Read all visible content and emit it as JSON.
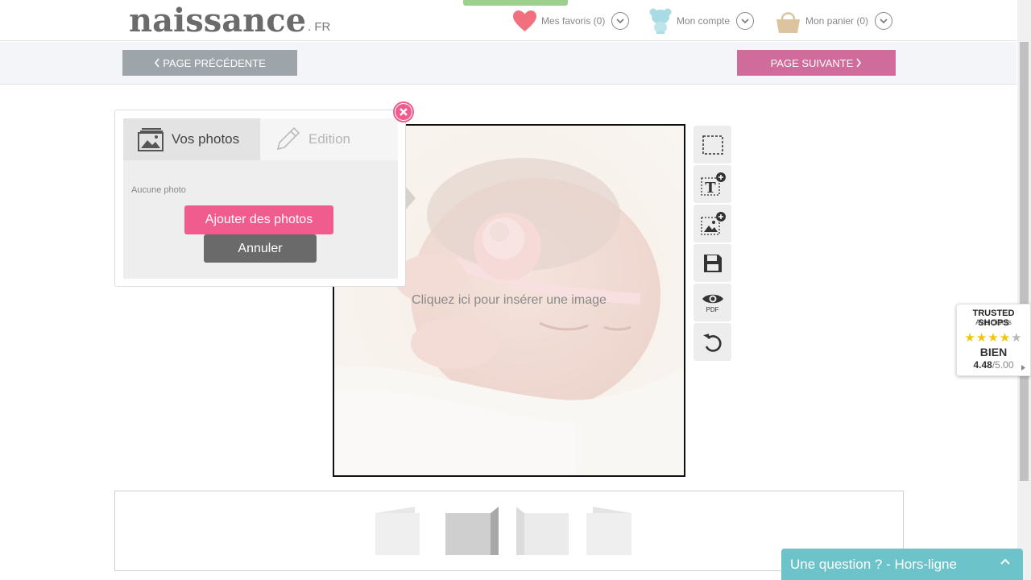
{
  "header": {
    "logo": "naissance",
    "logo_suffix": ". FR",
    "favorites_label": "Mes favoris (0)",
    "account_label": "Mon compte",
    "cart_label": "Mon panier (0)"
  },
  "nav": {
    "prev_label": "PAGE PRÉCÉDENTE",
    "next_label": "PAGE SUIVANTE"
  },
  "panel": {
    "tab_photos": "Vos photos",
    "tab_edition": "Edition",
    "empty_text": "Aucune photo",
    "add_button": "Ajouter des photos",
    "cancel_button": "Annuler"
  },
  "canvas": {
    "hint": "Cliquez ici pour insérer une image"
  },
  "tools": {
    "preview_pdf": "PDF",
    "icons": [
      "select-icon",
      "add-text-icon",
      "add-image-icon",
      "save-icon",
      "preview-pdf-icon",
      "undo-icon"
    ]
  },
  "trusted_shops": {
    "title": "TRUSTED SHOPS",
    "subtitle": "Avis clients",
    "stars": "★★★★★",
    "rating_word": "BIEN",
    "score": "4.48",
    "max": "/5.00",
    "rating_fraction": 0.896
  },
  "chat": {
    "label": "Une question ? - Hors-ligne"
  },
  "colors": {
    "accent_pink": "#f05c8e",
    "next_button": "#cf6c9b",
    "prev_button": "#9ea5aa",
    "chat": "#6cc3c9",
    "star": "#f5c400"
  }
}
